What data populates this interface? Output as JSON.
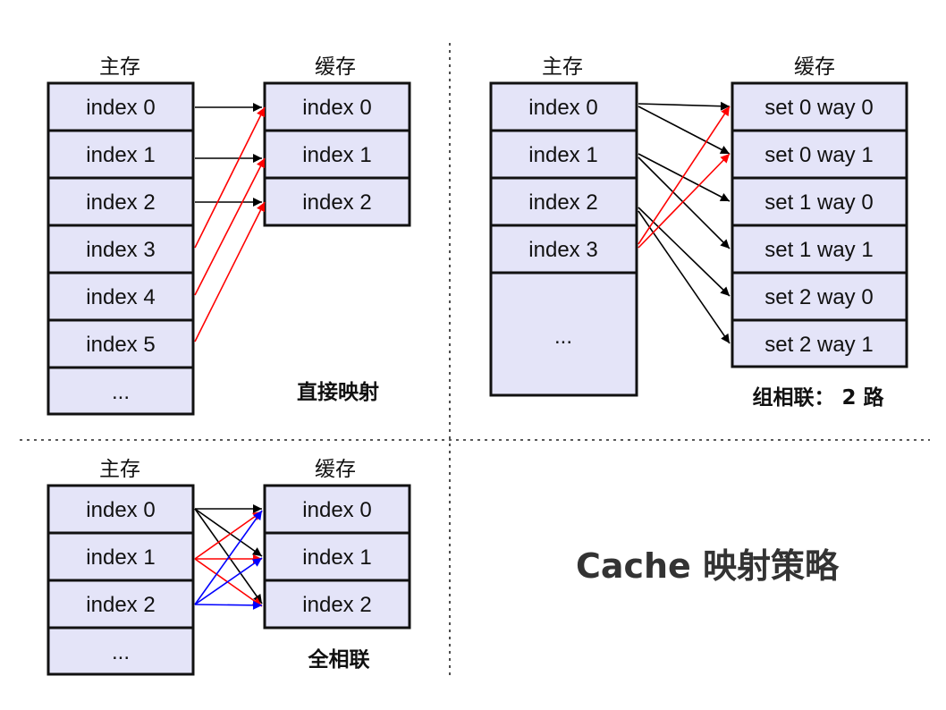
{
  "colors": {
    "cell_fill": "#e4e4f8",
    "black_arrow": "#000000",
    "red_arrow": "#ff0000",
    "blue_arrow": "#0000ff",
    "title": "#333333"
  },
  "direct": {
    "main_header": "主存",
    "cache_header": "缓存",
    "main_cells": [
      "index 0",
      "index 1",
      "index 2",
      "index 3",
      "index 4",
      "index 5",
      "..."
    ],
    "cache_cells": [
      "index 0",
      "index 1",
      "index 2"
    ],
    "label": "直接映射"
  },
  "set_assoc": {
    "main_header": "主存",
    "cache_header": "缓存",
    "main_cells": [
      "index 0",
      "index 1",
      "index 2",
      "index 3",
      "..."
    ],
    "cache_cells": [
      "set 0 way 0",
      "set 0 way 1",
      "set 1 way 0",
      "set 1 way 1",
      "set 2 way 0",
      "set 2 way 1"
    ],
    "label": "组相联： 2 路"
  },
  "fully": {
    "main_header": "主存",
    "cache_header": "缓存",
    "main_cells": [
      "index 0",
      "index 1",
      "index 2",
      "..."
    ],
    "cache_cells": [
      "index 0",
      "index 1",
      "index 2"
    ],
    "label": "全相联"
  },
  "title": "Cache 映射策略"
}
